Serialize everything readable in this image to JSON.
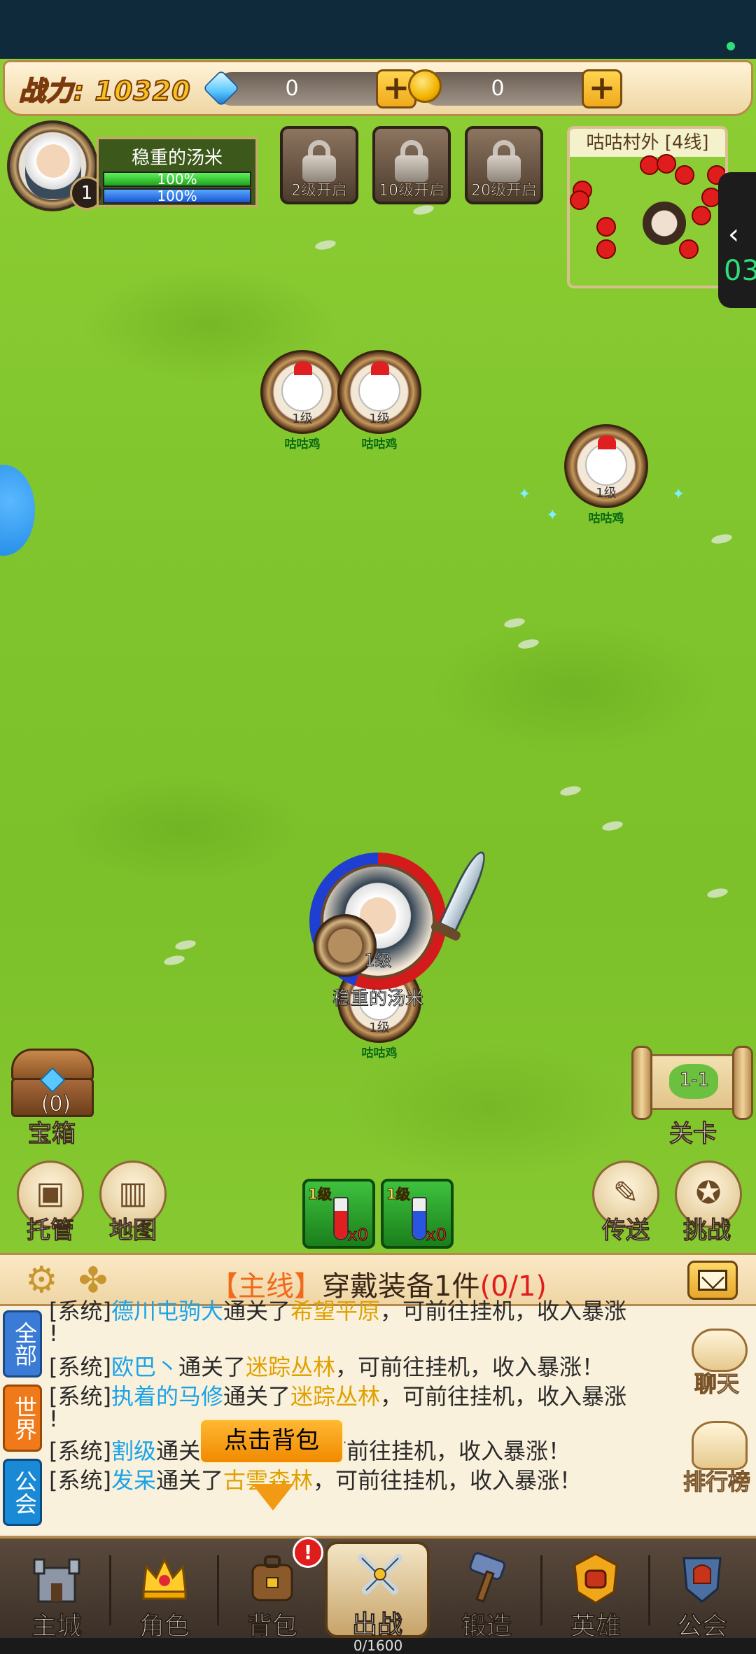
{
  "top_bar": {
    "power_label": "战力: 10320",
    "diamonds": "0",
    "gold": "0",
    "plus_symbol": "+"
  },
  "player": {
    "name": "稳重的汤米",
    "level": "1",
    "hp_text": "100%",
    "mp_text": "100%"
  },
  "locked_slots": [
    {
      "label": "2级开启"
    },
    {
      "label": "10级开启"
    },
    {
      "label": "20级开启"
    }
  ],
  "minimap": {
    "title": "咕咕村外 [4线]"
  },
  "side_tab": {
    "chevron": "‹",
    "number": "03"
  },
  "monsters": [
    {
      "level": "1级",
      "name": "咕咕鸡"
    },
    {
      "level": "1级",
      "name": "咕咕鸡"
    },
    {
      "level": "1级",
      "name": "咕咕鸡"
    },
    {
      "level": "1级",
      "name": "咕咕鸡"
    }
  ],
  "hero": {
    "level": "1级",
    "name": "稳重的汤米"
  },
  "field_buttons": {
    "chest_count": "(0)",
    "chest_label": "宝箱",
    "stage_label": "关卡",
    "stage_number": "1-1",
    "manage_label": "托管",
    "map_label": "地图",
    "teleport_label": "传送",
    "challenge_label": "挑战"
  },
  "potions": [
    {
      "level": "1级",
      "count": "x0",
      "color": "#e02020"
    },
    {
      "level": "1级",
      "count": "x0",
      "color": "#2a55e0"
    }
  ],
  "quest": {
    "tag": "【主线】",
    "text": "穿戴装备1件",
    "progress": "(0/1)"
  },
  "chat": {
    "tabs": [
      {
        "label": "全部",
        "color": "#3a7bd5"
      },
      {
        "label": "世界",
        "color": "#f07a1a"
      },
      {
        "label": "公会",
        "color": "#1a8ad6"
      }
    ],
    "lines": [
      {
        "prefix": "[系统]",
        "name": "德川屯驹大",
        "mid": "通关了",
        "place": "希望平原",
        "suffix": "，可前往挂机，收入暴涨"
      },
      {
        "prefix": "!",
        "name": "",
        "mid": "",
        "place": "",
        "suffix": ""
      },
      {
        "prefix": "[系统]",
        "name": "欧巴丶",
        "mid": "通关了",
        "place": "迷踪丛林",
        "suffix": "，可前往挂机，收入暴涨！"
      },
      {
        "prefix": "[系统]",
        "name": "执着的马修",
        "mid": "通关了",
        "place": "迷踪丛林",
        "suffix": "，可前往挂机，收入暴涨"
      },
      {
        "prefix": "!",
        "name": "",
        "mid": "",
        "place": "",
        "suffix": ""
      },
      {
        "prefix": "[系统]",
        "name": "割级",
        "mid": "通关",
        "place": "",
        "suffix": "可前往挂机，收入暴涨！"
      },
      {
        "prefix": "[系统]",
        "name": "发呆",
        "mid": "通关了",
        "place": "古雲森林",
        "suffix": "，可前往挂机，收入暴涨！"
      }
    ],
    "chat_button": "聊天",
    "rank_button": "排行榜",
    "tip": "点击背包"
  },
  "bottom_nav": {
    "items": [
      {
        "label": "主城",
        "icon": "castle-icon"
      },
      {
        "label": "角色",
        "icon": "crown-icon"
      },
      {
        "label": "背包",
        "icon": "backpack-icon"
      },
      {
        "label": "出战",
        "icon": "crossed-swords-icon"
      },
      {
        "label": "锻造",
        "icon": "hammer-icon"
      },
      {
        "label": "英雄",
        "icon": "fist-icon"
      },
      {
        "label": "公会",
        "icon": "helmet-shield-icon"
      }
    ],
    "backpack_badge": "!"
  },
  "footer": {
    "capacity": "0/1600"
  },
  "colors": {
    "grass": "#80c52d",
    "panel": "#f3e0b8",
    "accent_orange": "#f06a1a",
    "hp_green": "#21a21d",
    "mp_blue": "#1b55d1"
  }
}
